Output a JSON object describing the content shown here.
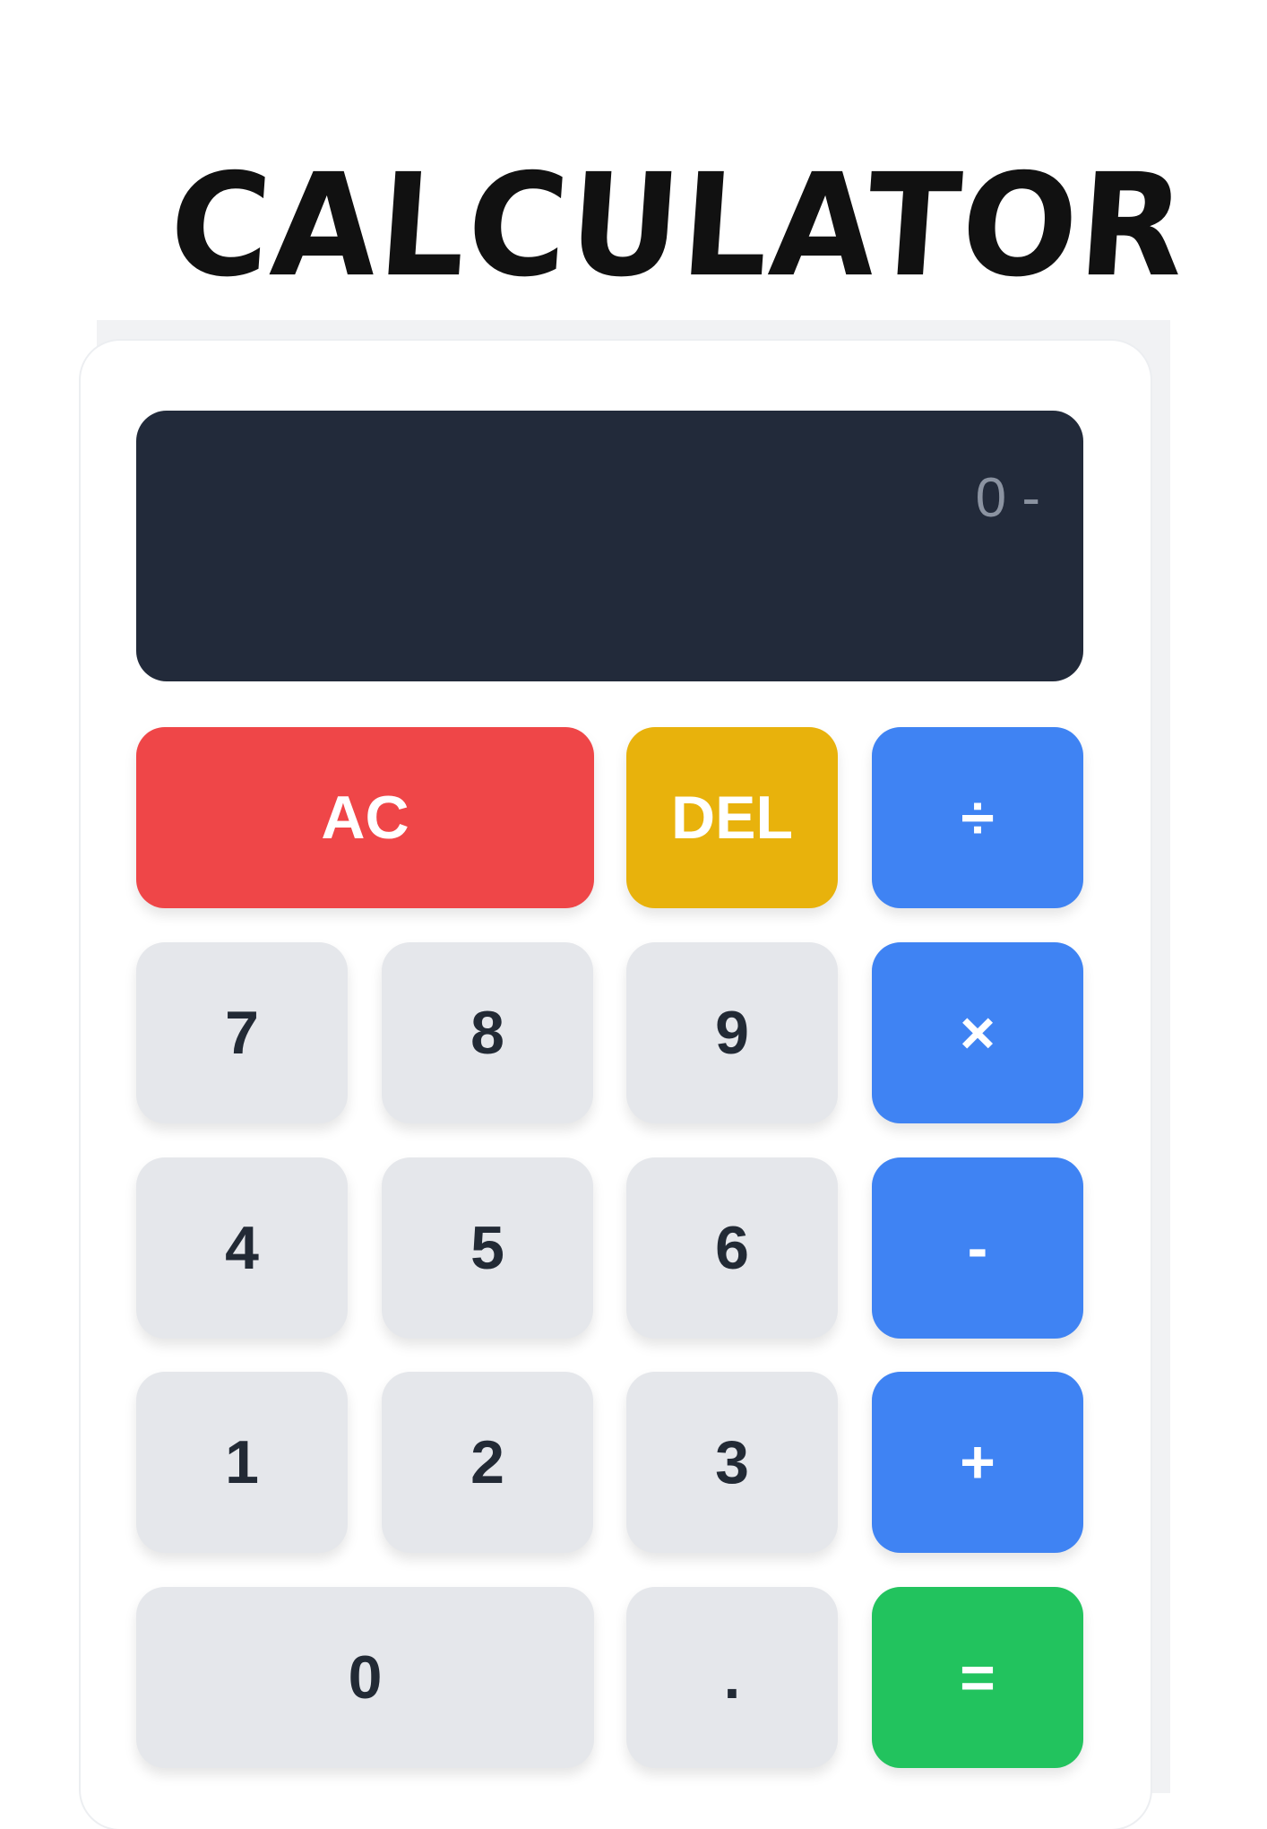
{
  "title": "CALCULATOR",
  "display": {
    "value": "0 -"
  },
  "buttons": {
    "ac": "AC",
    "del": "DEL",
    "divide": "÷",
    "seven": "7",
    "eight": "8",
    "nine": "9",
    "multiply": "×",
    "four": "4",
    "five": "5",
    "six": "6",
    "subtract": "-",
    "one": "1",
    "two": "2",
    "three": "3",
    "add": "+",
    "zero": "0",
    "decimal": ".",
    "equals": "="
  },
  "colors": {
    "clear": "#ef4648",
    "delete": "#e8b20c",
    "operator": "#3f83f3",
    "equals": "#22c35e",
    "number": "#e5e7eb",
    "display": "#222a3a"
  }
}
